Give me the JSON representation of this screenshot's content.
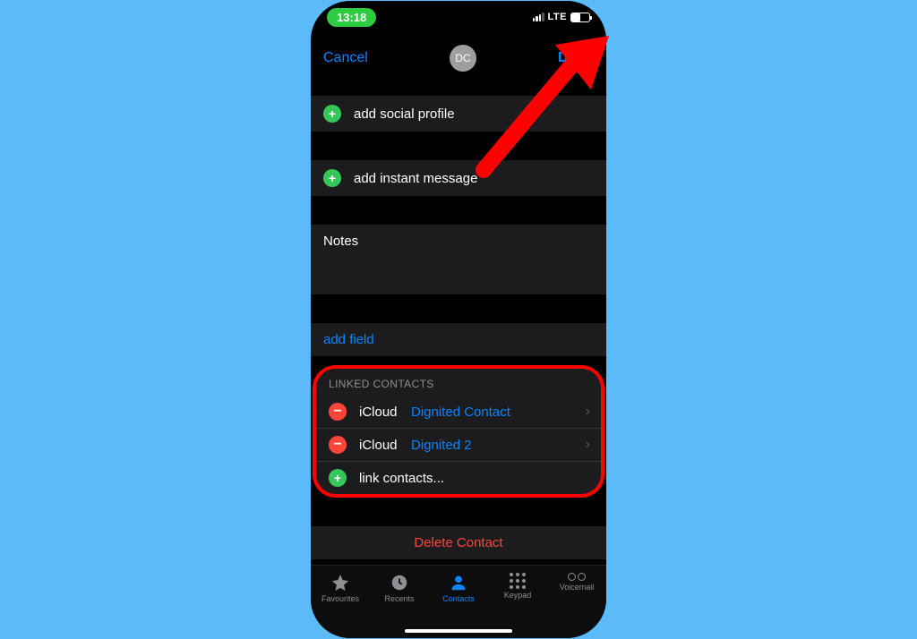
{
  "status": {
    "time": "13:18",
    "network": "LTE"
  },
  "header": {
    "cancel": "Cancel",
    "done": "Done",
    "initials": "DC"
  },
  "rows": {
    "add_social": "add social profile",
    "add_im": "add instant message",
    "notes": "Notes",
    "add_field": "add field"
  },
  "linked": {
    "header": "LINKED CONTACTS",
    "items": [
      {
        "source": "iCloud",
        "name": "Dignited Contact"
      },
      {
        "source": "iCloud",
        "name": "Dignited  2"
      }
    ],
    "link_more": "link contacts..."
  },
  "delete_label": "Delete Contact",
  "tabs": {
    "favourites": "Favourites",
    "recents": "Recents",
    "contacts": "Contacts",
    "keypad": "Keypad",
    "voicemail": "Voicemail"
  }
}
